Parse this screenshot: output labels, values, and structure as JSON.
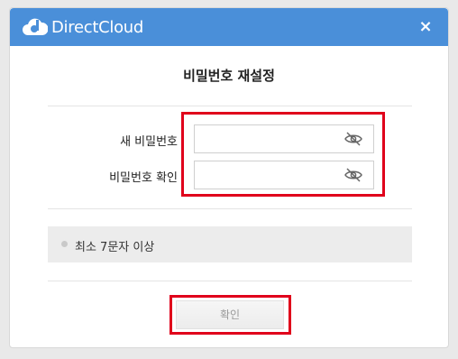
{
  "header": {
    "logo_text": "DirectCloud",
    "close_label": "×"
  },
  "title": "비밀번호 재설정",
  "form": {
    "new_password_label": "새 비밀번호",
    "new_password_value": "",
    "confirm_password_label": "비밀번호 확인",
    "confirm_password_value": ""
  },
  "hint": {
    "text": "최소 7문자 이상"
  },
  "confirm_button_label": "확인",
  "icons": {
    "password_toggle": "eye-slash-icon",
    "logo": "cloud-logo-icon"
  },
  "colors": {
    "header_bg": "#4a8fd9",
    "highlight": "#e0001b"
  }
}
